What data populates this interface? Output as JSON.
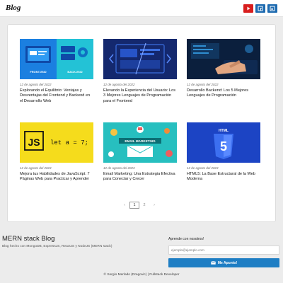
{
  "header": {
    "logo": "Blog",
    "social": [
      {
        "name": "youtube-icon",
        "color": "#d81e1e"
      },
      {
        "name": "facebook-icon",
        "color": "#1e6bb0"
      },
      {
        "name": "linkedin-icon",
        "color": "#1e6bb0"
      }
    ]
  },
  "posts": [
    {
      "date": "12 de agosto del 2022",
      "title": "Explorando el Equilibrio: Ventajas y Desventajas del Frontend y Backend en el Desarrollo Web",
      "thumb_labels": [
        "FRONT-END",
        "BACK-END"
      ]
    },
    {
      "date": "12 de agosto del 2022",
      "title": "Elevando la Experiencia del Usuario: Los 3 Mejores Lenguajes de Programación para el Frontend"
    },
    {
      "date": "12 de agosto del 2022",
      "title": "Desarrollo Backend: Los 5 Mejores Lenguajes de Programación"
    },
    {
      "date": "12 de agosto del 2023",
      "title": "Mejora tus Habilidades de JavaScript: 7 Páginas Web para Practicar y Aprender",
      "thumb_labels": [
        "JS",
        "let a = 7;"
      ]
    },
    {
      "date": "12 de agosto del 2023",
      "title": "Email Marketing: Una Estrategia Efectiva para Conectar y Crecer",
      "thumb_labels": [
        "EMAIL MARKETING"
      ]
    },
    {
      "date": "12 de agosto del 2023",
      "title": "HTML5: La Base Estructural de la Web Moderna",
      "thumb_labels": [
        "HTML",
        "5"
      ]
    }
  ],
  "pagination": {
    "prev": "‹",
    "pages": [
      "1",
      "2"
    ],
    "next": "›",
    "current": "1"
  },
  "footer": {
    "title": "MERN stack Blog",
    "description": "Blog hecho con MongoDB, ExpressJS, ReactJS y NodeJS (MERN stack)",
    "subscribe_label": "Aprende con nosotros!",
    "email_placeholder": "ejemplo@ejemplo.com",
    "button_label": "Me Apunto!",
    "copyright": "© Sergio Merlado (Dragovic) | Fullstack Developer"
  }
}
